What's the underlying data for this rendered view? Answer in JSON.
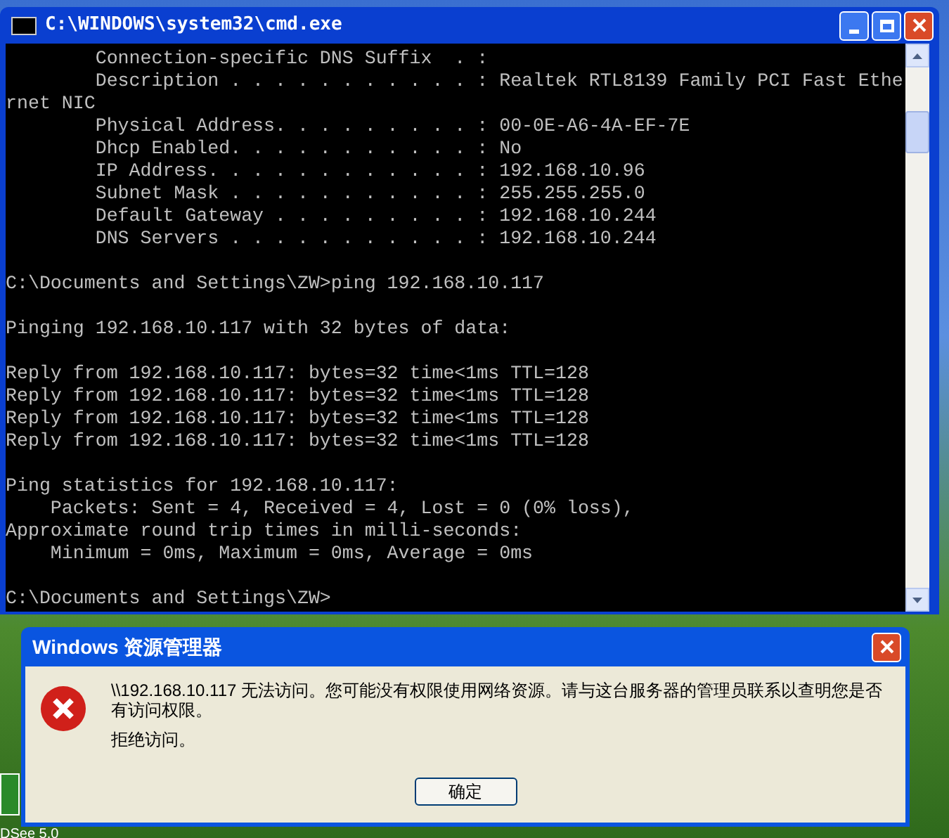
{
  "console_window": {
    "title": "C:\\WINDOWS\\system32\\cmd.exe",
    "lines": [
      {
        "kind": "text",
        "text": "        Connection-specific DNS Suffix  . :"
      },
      {
        "kind": "text",
        "text": "        Description . . . . . . . . . . . : Realtek RTL8139 Family PCI Fast Ethe"
      },
      {
        "kind": "text",
        "text": "rnet NIC"
      },
      {
        "kind": "text",
        "text": "        Physical Address. . . . . . . . . : 00-0E-A6-4A-EF-7E"
      },
      {
        "kind": "text",
        "text": "        Dhcp Enabled. . . . . . . . . . . : No"
      },
      {
        "kind": "text",
        "text": "        IP Address. . . . . . . . . . . . : 192.168.10.96"
      },
      {
        "kind": "text",
        "text": "        Subnet Mask . . . . . . . . . . . : 255.255.255.0"
      },
      {
        "kind": "text",
        "text": "        Default Gateway . . . . . . . . . : 192.168.10.244"
      },
      {
        "kind": "text",
        "text": "        DNS Servers . . . . . . . . . . . : 192.168.10.244"
      },
      {
        "kind": "blank"
      },
      {
        "kind": "text",
        "text": "C:\\Documents and Settings\\ZW>ping 192.168.10.117"
      },
      {
        "kind": "blank"
      },
      {
        "kind": "text",
        "text": "Pinging 192.168.10.117 with 32 bytes of data:"
      },
      {
        "kind": "blank"
      },
      {
        "kind": "text",
        "text": "Reply from 192.168.10.117: bytes=32 time<1ms TTL=128"
      },
      {
        "kind": "text",
        "text": "Reply from 192.168.10.117: bytes=32 time<1ms TTL=128"
      },
      {
        "kind": "text",
        "text": "Reply from 192.168.10.117: bytes=32 time<1ms TTL=128"
      },
      {
        "kind": "text",
        "text": "Reply from 192.168.10.117: bytes=32 time<1ms TTL=128"
      },
      {
        "kind": "blank"
      },
      {
        "kind": "text",
        "text": "Ping statistics for 192.168.10.117:"
      },
      {
        "kind": "text",
        "text": "    Packets: Sent = 4, Received = 4, Lost = 0 (0% loss),"
      },
      {
        "kind": "text",
        "text": "Approximate round trip times in milli-seconds:"
      },
      {
        "kind": "text",
        "text": "    Minimum = 0ms, Maximum = 0ms, Average = 0ms"
      },
      {
        "kind": "blank"
      },
      {
        "kind": "text",
        "text": "C:\\Documents and Settings\\ZW>"
      }
    ]
  },
  "desktop_icons": [
    {
      "label": "DSee 5.0"
    }
  ],
  "error_dialog": {
    "title": "Windows 资源管理器",
    "message": "\\\\192.168.10.117 无法访问。您可能没有权限使用网络资源。请与这台服务器的管理员联系以查明您是否有访问权限。",
    "detail": "拒绝访问。",
    "button": "确定"
  }
}
